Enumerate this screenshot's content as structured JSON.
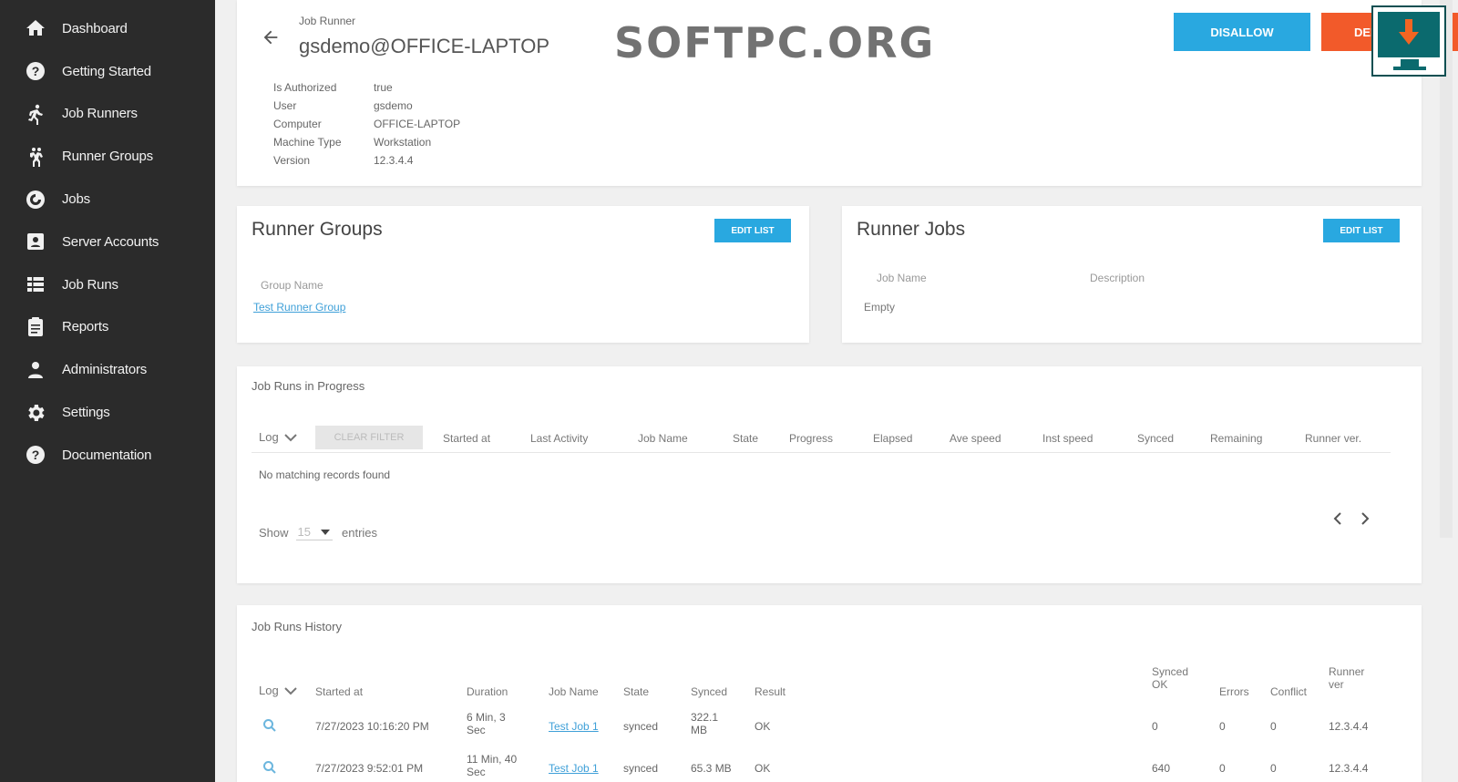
{
  "sidebar": {
    "items": [
      {
        "label": "Dashboard",
        "icon": "home-icon"
      },
      {
        "label": "Getting Started",
        "icon": "help-icon"
      },
      {
        "label": "Job Runners",
        "icon": "runner-icon"
      },
      {
        "label": "Runner Groups",
        "icon": "runner-group-icon"
      },
      {
        "label": "Jobs",
        "icon": "jobs-icon"
      },
      {
        "label": "Server Accounts",
        "icon": "server-account-icon"
      },
      {
        "label": "Job Runs",
        "icon": "grid-icon"
      },
      {
        "label": "Reports",
        "icon": "report-icon"
      },
      {
        "label": "Administrators",
        "icon": "person-icon"
      },
      {
        "label": "Settings",
        "icon": "gear-icon"
      },
      {
        "label": "Documentation",
        "icon": "help-icon"
      }
    ]
  },
  "header": {
    "kind": "Job Runner",
    "name": "gsdemo@OFFICE-LAPTOP",
    "watermark": "SOFTPC.ORG",
    "disallow_label": "DISALLOW",
    "delete_label": "DELET",
    "info": [
      {
        "key": "Is Authorized",
        "value": "true"
      },
      {
        "key": "User",
        "value": "gsdemo"
      },
      {
        "key": "Computer",
        "value": "OFFICE-LAPTOP"
      },
      {
        "key": "Machine Type",
        "value": "Workstation"
      },
      {
        "key": "Version",
        "value": "12.3.4.4"
      }
    ]
  },
  "runner_groups": {
    "title": "Runner Groups",
    "edit_label": "EDIT LIST",
    "column": "Group Name",
    "rows": [
      "Test Runner Group"
    ]
  },
  "runner_jobs": {
    "title": "Runner Jobs",
    "edit_label": "EDIT LIST",
    "columns": [
      "Job Name",
      "Description"
    ],
    "empty": "Empty"
  },
  "in_progress": {
    "title": "Job Runs in Progress",
    "log_label": "Log",
    "clear_filter": "CLEAR FILTER",
    "columns": [
      "Started at",
      "Last Activity",
      "Job Name",
      "State",
      "Progress",
      "Elapsed",
      "Ave speed",
      "Inst speed",
      "Synced",
      "Remaining",
      "Runner ver."
    ],
    "empty": "No matching records found",
    "show_label": "Show",
    "show_value": "15",
    "entries_label": "entries"
  },
  "history": {
    "title": "Job Runs History",
    "log_label": "Log",
    "columns": [
      "Started at",
      "Duration",
      "Job Name",
      "State",
      "Synced",
      "Result",
      "Synced OK",
      "Errors",
      "Conflict",
      "Runner ver"
    ],
    "rows": [
      {
        "started": "7/27/2023 10:16:20 PM",
        "duration": "6 Min, 3 Sec",
        "job": "Test Job 1",
        "state": "synced",
        "synced": "322.1 MB",
        "result": "OK",
        "synced_ok": "0",
        "errors": "0",
        "conflict": "0",
        "ver": "12.3.4.4"
      },
      {
        "started": "7/27/2023 9:52:01 PM",
        "duration": "11 Min, 40 Sec",
        "job": "Test Job 1",
        "state": "synced",
        "synced": "65.3 MB",
        "result": "OK",
        "synced_ok": "640",
        "errors": "0",
        "conflict": "0",
        "ver": "12.3.4.4"
      }
    ]
  },
  "colors": {
    "sidebar_bg": "#2b2b2b",
    "primary": "#29a8e0",
    "danger": "#f25a2a"
  }
}
